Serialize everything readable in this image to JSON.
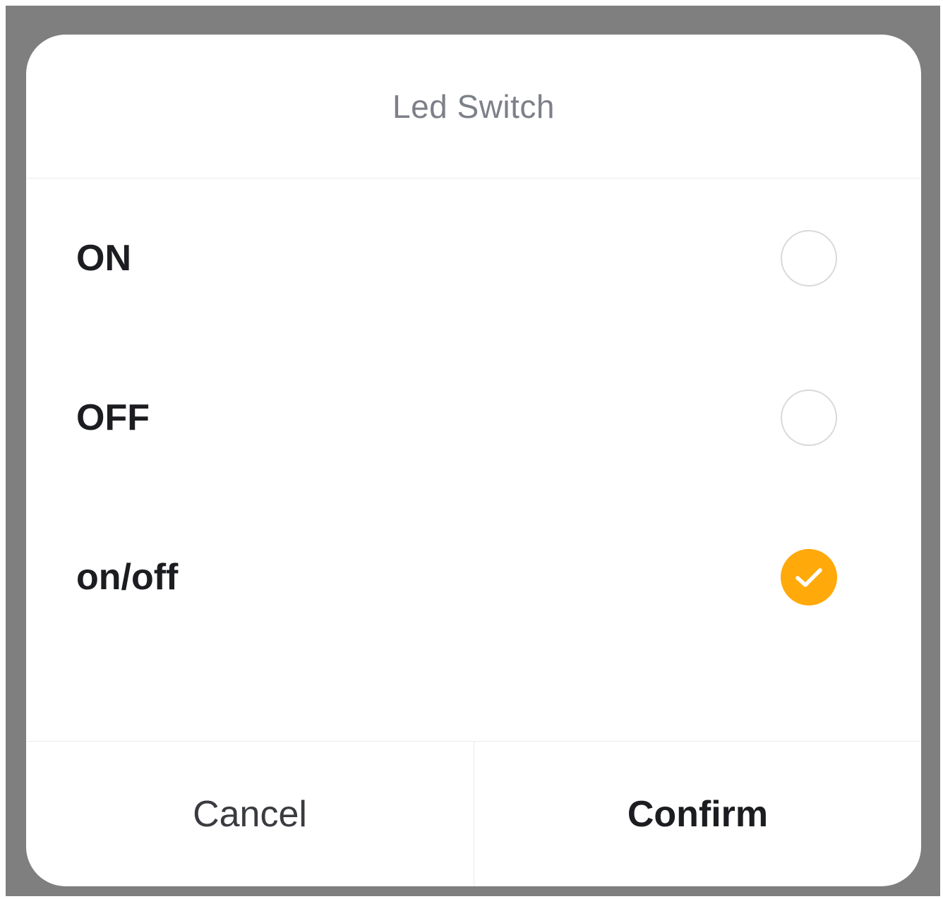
{
  "dialog": {
    "title": "Led Switch",
    "options": [
      {
        "label": "ON",
        "selected": false
      },
      {
        "label": "OFF",
        "selected": false
      },
      {
        "label": "on/off",
        "selected": true
      }
    ],
    "cancel_label": "Cancel",
    "confirm_label": "Confirm"
  },
  "colors": {
    "accent": "#ffa90b",
    "backdrop": "#7f7f7f",
    "title_text": "#7d8088"
  },
  "icons": {
    "selected": "check-icon"
  }
}
